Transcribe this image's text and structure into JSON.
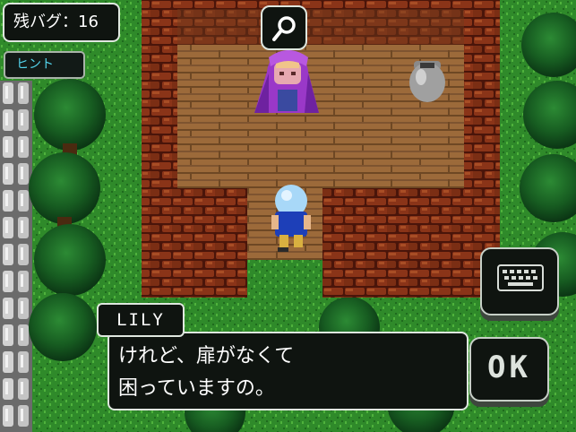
{
  "hud": {
    "bugs_label": "残バグ：16",
    "hint_label": "ヒント"
  },
  "dialog": {
    "speaker": "LILY",
    "line1": "けれど、扉がなくて",
    "line2": "困っていますの。"
  },
  "controls": {
    "ok_label": "OK",
    "search_icon": "magnifier-icon",
    "keyboard_icon": "keyboard-icon"
  },
  "colors": {
    "grass": "#2f8a2a",
    "floor": "#9c6a3a",
    "wall": "#7a2d14",
    "hint_text": "#54d6ee",
    "panel": "#0f1410",
    "panel_border": "#dfe7df",
    "mage_robe": "#9a38c8",
    "hero_hair": "#a8d8f8",
    "hero_shirt": "#1d3fb8"
  }
}
